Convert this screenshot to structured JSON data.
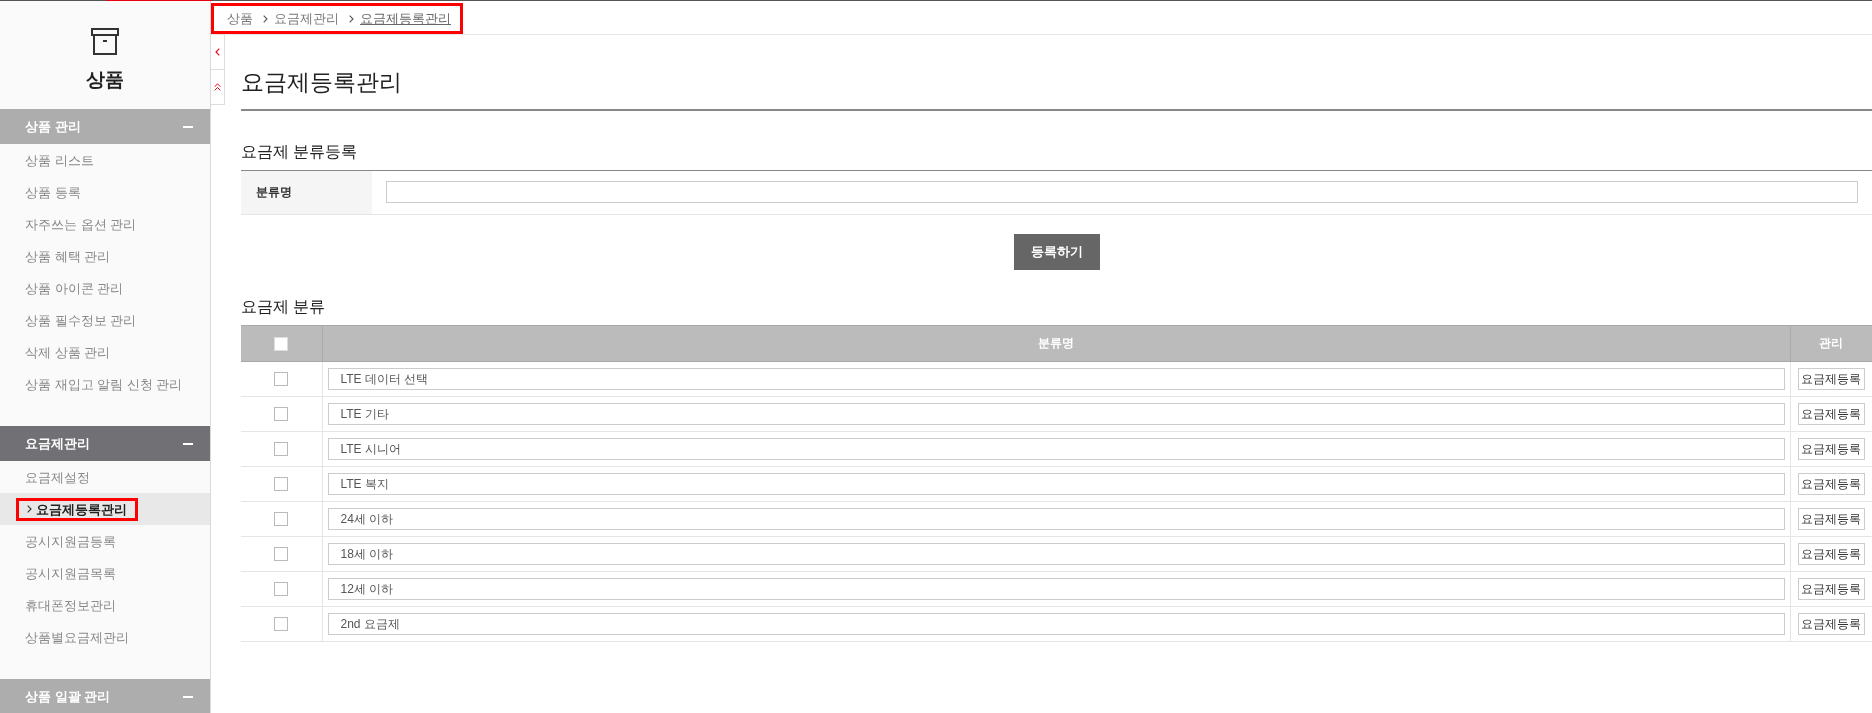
{
  "sidebar": {
    "title": "상품",
    "sections": [
      {
        "title": "상품 관리",
        "selected": false,
        "expanded": true,
        "items": [
          {
            "label": "상품 리스트",
            "selected": false,
            "highlighted": false
          },
          {
            "label": "상품 등록",
            "selected": false,
            "highlighted": false
          },
          {
            "label": "자주쓰는 옵션 관리",
            "selected": false,
            "highlighted": false
          },
          {
            "label": "상품 혜택 관리",
            "selected": false,
            "highlighted": false
          },
          {
            "label": "상품 아이콘 관리",
            "selected": false,
            "highlighted": false
          },
          {
            "label": "상품 필수정보 관리",
            "selected": false,
            "highlighted": false
          },
          {
            "label": "삭제 상품 관리",
            "selected": false,
            "highlighted": false
          },
          {
            "label": "상품 재입고 알림 신청 관리",
            "selected": false,
            "highlighted": false
          }
        ]
      },
      {
        "title": "요금제관리",
        "selected": true,
        "expanded": true,
        "items": [
          {
            "label": "요금제설정",
            "selected": false,
            "highlighted": false
          },
          {
            "label": "요금제등록관리",
            "selected": true,
            "highlighted": true
          },
          {
            "label": "공시지원금등록",
            "selected": false,
            "highlighted": false
          },
          {
            "label": "공시지원금목록",
            "selected": false,
            "highlighted": false
          },
          {
            "label": "휴대폰정보관리",
            "selected": false,
            "highlighted": false
          },
          {
            "label": "상품별요금제관리",
            "selected": false,
            "highlighted": false
          }
        ]
      },
      {
        "title": "상품 일괄 관리",
        "selected": false,
        "expanded": true
      }
    ]
  },
  "breadcrumb": {
    "highlighted": true,
    "items": [
      {
        "label": "상품",
        "current": false
      },
      {
        "label": "요금제관리",
        "current": false
      },
      {
        "label": "요금제등록관리",
        "current": true
      }
    ]
  },
  "page_title": "요금제등록관리",
  "registration": {
    "title": "요금제 분류등록",
    "fields": [
      {
        "label": "분류명"
      }
    ],
    "button": "등록하기"
  },
  "category_table": {
    "title": "요금제 분류",
    "select_all": {
      "checked": false
    },
    "columns": [
      "분류명",
      "관리"
    ],
    "rows": [
      {
        "checked": false,
        "value": "LTE 데이터 선택",
        "action": "요금제등록"
      },
      {
        "checked": false,
        "value": "LTE 기타",
        "action": "요금제등록"
      },
      {
        "checked": false,
        "value": "LTE 시니어",
        "action": "요금제등록"
      },
      {
        "checked": false,
        "value": "LTE 복지",
        "action": "요금제등록"
      },
      {
        "checked": false,
        "value": "24세 이하",
        "action": "요금제등록"
      },
      {
        "checked": false,
        "value": "18세 이하",
        "action": "요금제등록"
      },
      {
        "checked": false,
        "value": "12세 이하",
        "action": "요금제등록"
      },
      {
        "checked": false,
        "value": "2nd 요금제",
        "action": "요금제등록"
      }
    ]
  }
}
